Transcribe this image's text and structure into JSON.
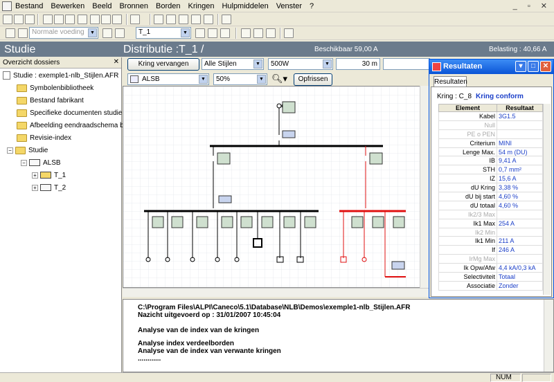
{
  "menu": [
    "Bestand",
    "Bewerken",
    "Beeld",
    "Bronnen",
    "Borden",
    "Kringen",
    "Hulpmiddelen",
    "Venster",
    "?"
  ],
  "toolbar2": {
    "voeding_placeholder": "Normale voeding",
    "board_select": "T_1"
  },
  "header": {
    "studie": "Studie",
    "distributie": "Distributie :T_1 /",
    "beschikbaar": "Beschikbaar 59,00 A",
    "belasting": "Belasting : 40,66 A"
  },
  "left_pane": {
    "title": "Overzicht dossiers",
    "study": "Studie : exemple1-nlb_Stijlen.AFR",
    "folders": [
      "Symbolenbibliotheek",
      "Bestand fabrikant",
      "Specifieke documenten studie",
      "Afbeelding eendraadschema bord",
      "Revisie-index",
      "Studie"
    ],
    "source": "ALSB",
    "boards": [
      "T_1",
      "T_2"
    ]
  },
  "controls": {
    "kring_vervangen": "Kring vervangen",
    "stijlen": "Alle Stijlen",
    "power": "500W",
    "distance": "30 m",
    "source_select": "ALSB",
    "zoom": "50%",
    "opfrissen": "Opfrissen"
  },
  "log": {
    "lines": [
      "C:\\Program Files\\ALPI\\Caneco\\5.1\\Database\\NLB\\Demos\\exemple1-nlb_Stijlen.AFR",
      "Nazicht uitgevoerd op : 31/01/2007 10:45:04",
      "",
      "Analyse van de index van de kringen",
      "",
      "Analyse index verdeelborden",
      "Analyse van de index van verwante kringen",
      "............"
    ]
  },
  "status": {
    "num": "NUM"
  },
  "results": {
    "title": "Resultaten",
    "tab": "Resultaten",
    "kring_label": "Kring : C_8",
    "kring_status": "Kring conform",
    "col_element": "Element",
    "col_resultaat": "Resultaat",
    "rows": [
      {
        "el": "Kabel",
        "val": "3G1.5",
        "enabled": true
      },
      {
        "el": "Null",
        "val": "",
        "enabled": false
      },
      {
        "el": "PE o PEN",
        "val": "",
        "enabled": false
      },
      {
        "el": "Criterium",
        "val": "MINI",
        "enabled": true
      },
      {
        "el": "Lenge Max.",
        "val": "54 m (DU)",
        "enabled": true
      },
      {
        "el": "IB",
        "val": "9,41 A",
        "enabled": true
      },
      {
        "el": "STH",
        "val": "0,7 mm²",
        "enabled": true
      },
      {
        "el": "IZ",
        "val": "15,6 A",
        "enabled": true
      },
      {
        "el": "dU Kring",
        "val": "3,38 %",
        "enabled": true
      },
      {
        "el": "dU bij start",
        "val": "4,60 %",
        "enabled": true
      },
      {
        "el": "dU totaal",
        "val": "4,60 %",
        "enabled": true
      },
      {
        "el": "Ik2/3 Max",
        "val": "",
        "enabled": false
      },
      {
        "el": "Ik1 Max",
        "val": "254 A",
        "enabled": true
      },
      {
        "el": "Ik2 Min",
        "val": "",
        "enabled": false
      },
      {
        "el": "Ik1 Min",
        "val": "211 A",
        "enabled": true
      },
      {
        "el": "If",
        "val": "246 A",
        "enabled": true
      },
      {
        "el": "IrMg Max",
        "val": "",
        "enabled": false
      },
      {
        "el": "Ik Opw/Afw",
        "val": "4,4 kA/0,3 kA",
        "enabled": true
      },
      {
        "el": "Selectiviteit",
        "val": "Totaal",
        "enabled": true
      },
      {
        "el": "Associatie",
        "val": "Zonder",
        "enabled": true
      }
    ]
  },
  "colors": {
    "header_strip": "#6b7b8c",
    "highlight_circuit": "#e01010",
    "result_value": "#1a3ec8"
  }
}
